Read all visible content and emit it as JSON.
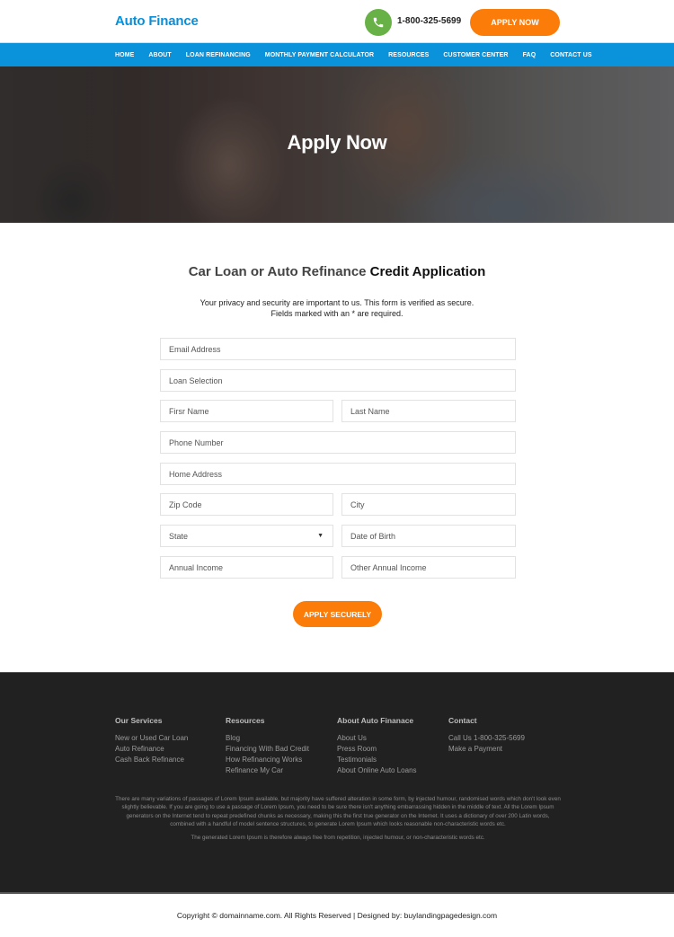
{
  "header": {
    "logo": "Auto Finance",
    "phone_icon": "phone-icon",
    "phone": "1-800-325-5699",
    "apply_now": "APPLY NOW"
  },
  "nav": {
    "items": [
      {
        "label": "HOME"
      },
      {
        "label": "ABOUT"
      },
      {
        "label": "LOAN REFINANCING"
      },
      {
        "label": "MONTHLY PAYMENT CALCULATOR"
      },
      {
        "label": "RESOURCES"
      },
      {
        "label": "CUSTOMER CENTER"
      },
      {
        "label": "FAQ"
      },
      {
        "label": "CONTACT US"
      }
    ]
  },
  "hero": {
    "title": "Apply Now"
  },
  "form": {
    "heading_light": "Car Loan or Auto Refinance ",
    "heading_bold": "Credit Application",
    "privacy_line1": "Your privacy and security are important to us. This form is verified as secure.",
    "privacy_line2": "Fields marked with an * are required.",
    "fields": {
      "email": "Email Address",
      "loan_selection": "Loan Selection",
      "first_name": "Firsr Name",
      "last_name": "Last Name",
      "phone": "Phone Number",
      "home_address": "Home Address",
      "zip": "Zip Code",
      "city": "City",
      "state": "State",
      "dob": "Date of Birth",
      "annual_income": "Annual Income",
      "other_income": "Other Annual Income"
    },
    "submit": "APPLY SECURELY"
  },
  "footer": {
    "columns": [
      {
        "title": "Our Services",
        "links": [
          "New or Used Car Loan",
          "Auto Refinance",
          "Cash Back Refinance"
        ]
      },
      {
        "title": "Resources",
        "links": [
          "Blog",
          "Financing With Bad Credit",
          "How Refinancing Works",
          "Refinance My Car"
        ]
      },
      {
        "title": "About Auto Finanace",
        "links": [
          "About Us",
          "Press Room",
          "Testimonials",
          "About Online Auto Loans"
        ]
      },
      {
        "title": "Contact",
        "links": [
          "Call Us 1-800-325-5699",
          "Make a Payment"
        ]
      }
    ],
    "paragraph1": "There are many variations of passages of Lorem Ipsum available, but majority have suffered alteration in some form, by injected humour, randomised words which don't look even slightly believable. If you are going to use a passage of Lorem Ipsum, you need to be sure there isn't anything embarrassing hidden in the middle of text. All the Lorem Ipsum generators on the Internet tend to repeat predefined chunks as necessary, making this the first true generator on the Internet. It uses a dictionary of over 200 Latin words, combined with a handful of model sentence structures, to generate Lorem Ipsum which looks reasonable non-characteristic words etc.",
    "paragraph2": "The generated Lorem Ipsum is therefore always free from repetition, injected humour, or non-characteristic words etc."
  },
  "copyright": "Copyright © domainname.com. All Rights Reserved  |  Designed by: buylandingpagedesign.com"
}
